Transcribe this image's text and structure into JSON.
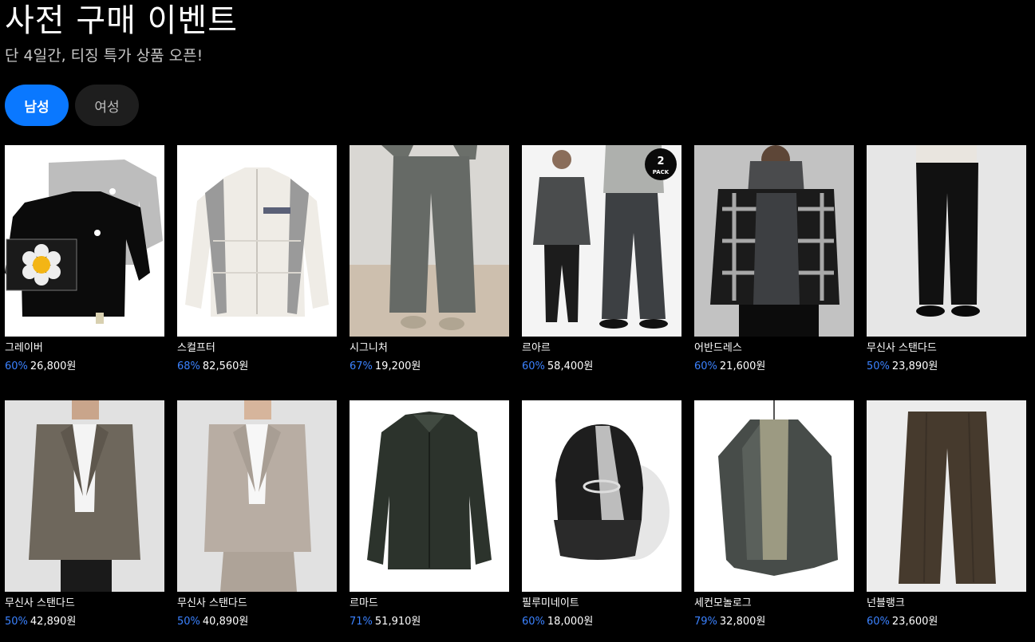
{
  "header": {
    "title": "사전 구매 이벤트",
    "subtitle": "단 4일간, 티징 특가 상품 오픈!"
  },
  "tabs": [
    {
      "label": "남성",
      "active": true
    },
    {
      "label": "여성",
      "active": false
    }
  ],
  "products": [
    {
      "brand": "그레이버",
      "discount": "60%",
      "price": "26,800원",
      "image": "sweatshirts-with-flower-icon"
    },
    {
      "brand": "스컬프터",
      "discount": "68%",
      "price": "82,560원",
      "image": "white-puffer-jacket"
    },
    {
      "brand": "시그니처",
      "discount": "67%",
      "price": "19,200원",
      "image": "grey-wide-pants"
    },
    {
      "brand": "르아르",
      "discount": "60%",
      "price": "58,400원",
      "image": "two-models-denim"
    },
    {
      "brand": "어반드레스",
      "discount": "60%",
      "price": "21,600원",
      "image": "check-shirt-hoodie"
    },
    {
      "brand": "무신사 스탠다드",
      "discount": "50%",
      "price": "23,890원",
      "image": "black-slacks"
    },
    {
      "brand": "무신사 스탠다드",
      "discount": "50%",
      "price": "42,890원",
      "image": "check-blazer"
    },
    {
      "brand": "무신사 스탠다드",
      "discount": "50%",
      "price": "40,890원",
      "image": "beige-suit"
    },
    {
      "brand": "르마드",
      "discount": "71%",
      "price": "51,910원",
      "image": "leather-jacket"
    },
    {
      "brand": "필루미네이트",
      "discount": "60%",
      "price": "18,000원",
      "image": "black-cap"
    },
    {
      "brand": "세컨모놀로그",
      "discount": "79%",
      "price": "32,800원",
      "image": "khaki-field-jacket"
    },
    {
      "brand": "넌블랭크",
      "discount": "60%",
      "price": "23,600원",
      "image": "brown-trousers"
    }
  ],
  "badge": {
    "line1": "2",
    "line2": "PACK"
  },
  "colors": {
    "accent": "#0a78ff",
    "discount": "#3b82ff",
    "background": "#000000"
  }
}
